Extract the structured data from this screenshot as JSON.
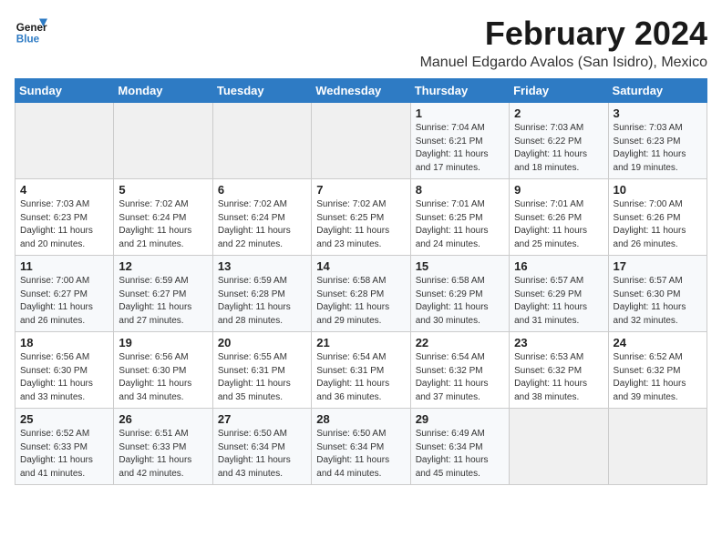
{
  "logo": {
    "line1": "General",
    "line2": "Blue"
  },
  "title": "February 2024",
  "subtitle": "Manuel Edgardo Avalos (San Isidro), Mexico",
  "days_of_week": [
    "Sunday",
    "Monday",
    "Tuesday",
    "Wednesday",
    "Thursday",
    "Friday",
    "Saturday"
  ],
  "weeks": [
    [
      {
        "day": "",
        "info": ""
      },
      {
        "day": "",
        "info": ""
      },
      {
        "day": "",
        "info": ""
      },
      {
        "day": "",
        "info": ""
      },
      {
        "day": "1",
        "info": "Sunrise: 7:04 AM\nSunset: 6:21 PM\nDaylight: 11 hours\nand 17 minutes."
      },
      {
        "day": "2",
        "info": "Sunrise: 7:03 AM\nSunset: 6:22 PM\nDaylight: 11 hours\nand 18 minutes."
      },
      {
        "day": "3",
        "info": "Sunrise: 7:03 AM\nSunset: 6:23 PM\nDaylight: 11 hours\nand 19 minutes."
      }
    ],
    [
      {
        "day": "4",
        "info": "Sunrise: 7:03 AM\nSunset: 6:23 PM\nDaylight: 11 hours\nand 20 minutes."
      },
      {
        "day": "5",
        "info": "Sunrise: 7:02 AM\nSunset: 6:24 PM\nDaylight: 11 hours\nand 21 minutes."
      },
      {
        "day": "6",
        "info": "Sunrise: 7:02 AM\nSunset: 6:24 PM\nDaylight: 11 hours\nand 22 minutes."
      },
      {
        "day": "7",
        "info": "Sunrise: 7:02 AM\nSunset: 6:25 PM\nDaylight: 11 hours\nand 23 minutes."
      },
      {
        "day": "8",
        "info": "Sunrise: 7:01 AM\nSunset: 6:25 PM\nDaylight: 11 hours\nand 24 minutes."
      },
      {
        "day": "9",
        "info": "Sunrise: 7:01 AM\nSunset: 6:26 PM\nDaylight: 11 hours\nand 25 minutes."
      },
      {
        "day": "10",
        "info": "Sunrise: 7:00 AM\nSunset: 6:26 PM\nDaylight: 11 hours\nand 26 minutes."
      }
    ],
    [
      {
        "day": "11",
        "info": "Sunrise: 7:00 AM\nSunset: 6:27 PM\nDaylight: 11 hours\nand 26 minutes."
      },
      {
        "day": "12",
        "info": "Sunrise: 6:59 AM\nSunset: 6:27 PM\nDaylight: 11 hours\nand 27 minutes."
      },
      {
        "day": "13",
        "info": "Sunrise: 6:59 AM\nSunset: 6:28 PM\nDaylight: 11 hours\nand 28 minutes."
      },
      {
        "day": "14",
        "info": "Sunrise: 6:58 AM\nSunset: 6:28 PM\nDaylight: 11 hours\nand 29 minutes."
      },
      {
        "day": "15",
        "info": "Sunrise: 6:58 AM\nSunset: 6:29 PM\nDaylight: 11 hours\nand 30 minutes."
      },
      {
        "day": "16",
        "info": "Sunrise: 6:57 AM\nSunset: 6:29 PM\nDaylight: 11 hours\nand 31 minutes."
      },
      {
        "day": "17",
        "info": "Sunrise: 6:57 AM\nSunset: 6:30 PM\nDaylight: 11 hours\nand 32 minutes."
      }
    ],
    [
      {
        "day": "18",
        "info": "Sunrise: 6:56 AM\nSunset: 6:30 PM\nDaylight: 11 hours\nand 33 minutes."
      },
      {
        "day": "19",
        "info": "Sunrise: 6:56 AM\nSunset: 6:30 PM\nDaylight: 11 hours\nand 34 minutes."
      },
      {
        "day": "20",
        "info": "Sunrise: 6:55 AM\nSunset: 6:31 PM\nDaylight: 11 hours\nand 35 minutes."
      },
      {
        "day": "21",
        "info": "Sunrise: 6:54 AM\nSunset: 6:31 PM\nDaylight: 11 hours\nand 36 minutes."
      },
      {
        "day": "22",
        "info": "Sunrise: 6:54 AM\nSunset: 6:32 PM\nDaylight: 11 hours\nand 37 minutes."
      },
      {
        "day": "23",
        "info": "Sunrise: 6:53 AM\nSunset: 6:32 PM\nDaylight: 11 hours\nand 38 minutes."
      },
      {
        "day": "24",
        "info": "Sunrise: 6:52 AM\nSunset: 6:32 PM\nDaylight: 11 hours\nand 39 minutes."
      }
    ],
    [
      {
        "day": "25",
        "info": "Sunrise: 6:52 AM\nSunset: 6:33 PM\nDaylight: 11 hours\nand 41 minutes."
      },
      {
        "day": "26",
        "info": "Sunrise: 6:51 AM\nSunset: 6:33 PM\nDaylight: 11 hours\nand 42 minutes."
      },
      {
        "day": "27",
        "info": "Sunrise: 6:50 AM\nSunset: 6:34 PM\nDaylight: 11 hours\nand 43 minutes."
      },
      {
        "day": "28",
        "info": "Sunrise: 6:50 AM\nSunset: 6:34 PM\nDaylight: 11 hours\nand 44 minutes."
      },
      {
        "day": "29",
        "info": "Sunrise: 6:49 AM\nSunset: 6:34 PM\nDaylight: 11 hours\nand 45 minutes."
      },
      {
        "day": "",
        "info": ""
      },
      {
        "day": "",
        "info": ""
      }
    ]
  ]
}
